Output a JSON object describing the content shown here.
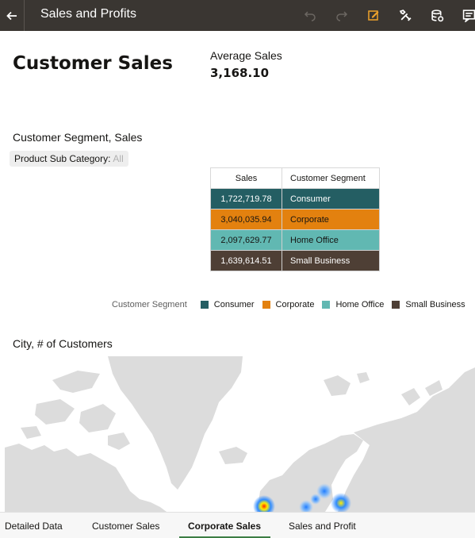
{
  "header": {
    "title": "Sales and Profits",
    "icons": [
      "back-arrow-icon",
      "undo-icon",
      "redo-icon",
      "edit-icon",
      "tools-icon",
      "data-icon",
      "narrate-icon"
    ]
  },
  "canvas": {
    "title": "Customer Sales",
    "kpi": {
      "label": "Average Sales",
      "value": "3,168.10"
    },
    "segment_viz": {
      "title": "Customer Segment, Sales",
      "filter": {
        "label": "Product Sub Category:",
        "value": "All"
      },
      "table": {
        "headers": [
          "Sales",
          "Customer Segment"
        ],
        "rows": [
          {
            "sales": "1,722,719.78",
            "segment": "Consumer"
          },
          {
            "sales": "3,040,035.94",
            "segment": "Corporate"
          },
          {
            "sales": "2,097,629.77",
            "segment": "Home Office"
          },
          {
            "sales": "1,639,614.51",
            "segment": "Small Business"
          }
        ]
      },
      "legend": {
        "title": "Customer Segment",
        "items": [
          "Consumer",
          "Corporate",
          "Home Office",
          "Small Business"
        ]
      }
    },
    "map_viz": {
      "title": "City, # of Customers"
    }
  },
  "tabs": [
    {
      "label": "Detailed Data",
      "active": false
    },
    {
      "label": "Customer Sales",
      "active": false
    },
    {
      "label": "Corporate Sales",
      "active": true
    },
    {
      "label": "Sales and Profit",
      "active": false
    }
  ],
  "colors": {
    "topbar": "#3a3632",
    "consumer": "#245e63",
    "corporate": "#e3810f",
    "home_office": "#61b8b2",
    "small_business": "#4e3f35",
    "active_tab": "#3c7d44",
    "edit_accent": "#f0a32a"
  }
}
